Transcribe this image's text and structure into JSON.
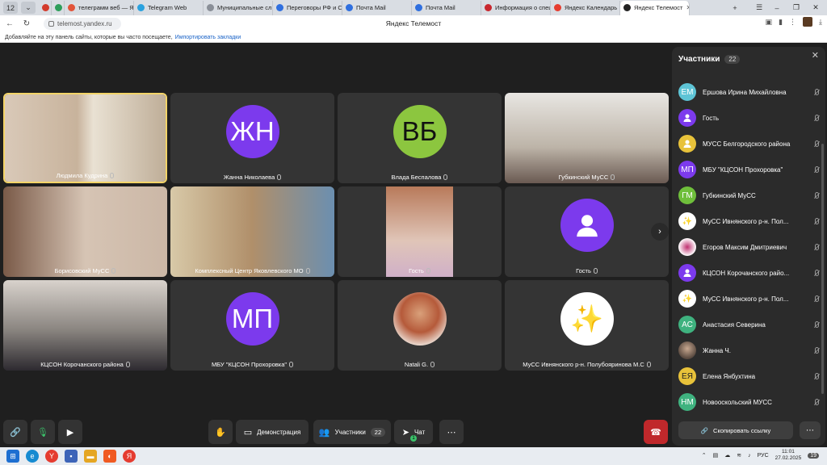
{
  "browser": {
    "tab_count": "12",
    "tabs": [
      {
        "label": "",
        "color": "#d33b2c"
      },
      {
        "label": "",
        "color": "#2e9e5b"
      },
      {
        "label": "телеграмм веб — Я",
        "color": "#e2543a"
      },
      {
        "label": "Telegram Web",
        "color": "#2aa2df"
      },
      {
        "label": "Муниципальные сл",
        "color": "#8a8f98"
      },
      {
        "label": "Переговоры РФ и С",
        "color": "#2f6fdf"
      },
      {
        "label": "Почта Mail",
        "color": "#2f6fdf"
      },
      {
        "label": "Почта Mail",
        "color": "#2f6fdf"
      },
      {
        "label": "Информация о спец",
        "color": "#c8272e"
      },
      {
        "label": "Яндекс Календарь",
        "color": "#e63c2f"
      },
      {
        "label": "Яндекс Телемост",
        "color": "#222222"
      }
    ],
    "url": "telemost.yandex.ru",
    "page_title": "Яндекс Телемост",
    "bookmarks_hint": "Добавляйте на эту панель сайты, которые вы часто посещаете,",
    "bookmarks_link": "Импортировать закладки"
  },
  "tiles": [
    {
      "name": "Людмила Кудрина",
      "type": "video",
      "scene": "two-women"
    },
    {
      "name": "Жанна Николаева",
      "type": "avatar",
      "initials": "ЖН",
      "color": "#7c3aed"
    },
    {
      "name": "Влада Беспалова",
      "type": "avatar",
      "initials": "ВБ",
      "color": "#8cc63f"
    },
    {
      "name": "Губкинский МуСС",
      "type": "video",
      "scene": "woman-glasses"
    },
    {
      "name": "Борисовский МуСС",
      "type": "video",
      "scene": "two-girls"
    },
    {
      "name": "Комплексный Центр Яковлевского МО",
      "type": "video",
      "scene": "office"
    },
    {
      "name": "Гость",
      "type": "video",
      "scene": "blurry"
    },
    {
      "name": "Гость",
      "type": "avatar",
      "initials": "",
      "color": "#7c3aed",
      "icon": "user-icon"
    },
    {
      "name": "КЦСОН Корочанского района",
      "type": "video",
      "scene": "man-woman"
    },
    {
      "name": "МБУ \"КЦСОН Прохоровка\"",
      "type": "avatar",
      "initials": "МП",
      "color": "#7c3aed"
    },
    {
      "name": "Natali G.",
      "type": "photo",
      "color": "#c9a27b"
    },
    {
      "name": "МуСС Ивнянского р-н. Полубояринова М.С",
      "type": "avatar",
      "initials": "✨",
      "color": "#ffffff"
    }
  ],
  "panel": {
    "title": "Участники",
    "count": "22",
    "participants": [
      {
        "initials": "ЕМ",
        "name": "Ершова Ирина Михайловна",
        "color": "#5ec4d6"
      },
      {
        "initials": "",
        "name": "Гость",
        "color": "#7c3aed",
        "icon": "user-icon"
      },
      {
        "initials": "",
        "name": "МУСС Белгородского района",
        "color": "#e8c23a",
        "icon": "user-icon"
      },
      {
        "initials": "МП",
        "name": "МБУ \"КЦСОН Прохоровка\"",
        "color": "#7c3aed"
      },
      {
        "initials": "ГМ",
        "name": "Губкинский МуСС",
        "color": "#6fbf3b"
      },
      {
        "initials": "✨",
        "name": "МуСС Ивнянского р-н. Пол...",
        "color": "#ffffff"
      },
      {
        "initials": "",
        "name": "Егоров Максим Дмитриевич",
        "color": "#ffffff",
        "icon": "logo-icon"
      },
      {
        "initials": "",
        "name": "КЦСОН Корочанского райо...",
        "color": "#7c3aed",
        "icon": "user-icon"
      },
      {
        "initials": "✨",
        "name": "МуСС Ивнянского р-н. Пол...",
        "color": "#ffffff"
      },
      {
        "initials": "АС",
        "name": "Анастасия Северина",
        "color": "#3fb27f"
      },
      {
        "initials": "",
        "name": "Жанна Ч.",
        "color": "#9b7a64",
        "icon": "photo-icon"
      },
      {
        "initials": "ЕЯ",
        "name": "Елена Янбухтина",
        "color": "#e8c23a"
      },
      {
        "initials": "НМ",
        "name": "Новооскольский МУСС",
        "color": "#3fb27f"
      }
    ],
    "copy_link": "Скопировать ссылку"
  },
  "toolbar": {
    "demo": "Демонстрация",
    "participants": "Участники",
    "participants_count": "22",
    "chat": "Чат",
    "chat_badge": "1"
  },
  "taskbar": {
    "lang": "РУС",
    "time": "11:01",
    "date": "27.02.2025",
    "notif": "19"
  }
}
